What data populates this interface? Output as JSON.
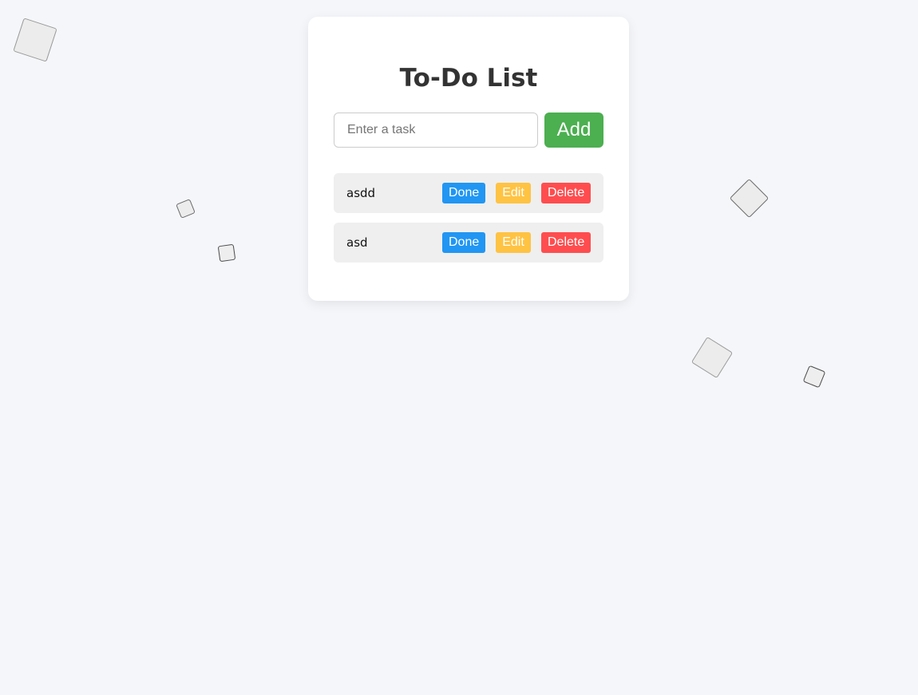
{
  "app": {
    "title": "To-Do List"
  },
  "input": {
    "placeholder": "Enter a task",
    "value": ""
  },
  "add_button": {
    "label": "Add"
  },
  "tasks": [
    {
      "text": "asdd",
      "done_label": "Done",
      "edit_label": "Edit",
      "delete_label": "Delete"
    },
    {
      "text": "asd",
      "done_label": "Done",
      "edit_label": "Edit",
      "delete_label": "Delete"
    }
  ],
  "colors": {
    "background": "#f5f6fa",
    "add": "#4caf50",
    "done": "#2196f3",
    "edit": "#ffc343",
    "delete": "#ff4d4f"
  }
}
